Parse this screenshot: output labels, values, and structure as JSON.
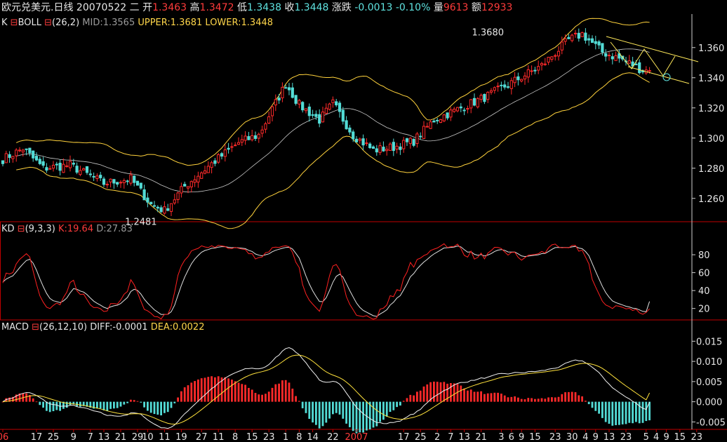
{
  "quote": {
    "name": "欧元兑美元.日线",
    "date": "20070522",
    "weekday": "二",
    "open_label": "开",
    "open": "1.3463",
    "high_label": "高",
    "high": "1.3472",
    "low_label": "低",
    "low": "1.3438",
    "close_label": "收",
    "close": "1.3448",
    "change_label": "涨跌",
    "change": "-0.0013",
    "change_pct": "-0.10%",
    "volume_label": "量",
    "volume": "9613",
    "amount_label": "额",
    "amount": "12933"
  },
  "panels": {
    "boll": {
      "label": "K",
      "name": "BOLL",
      "params": "(26,2)",
      "mid": "MID:1.3565",
      "upper": "UPPER:1.3681",
      "lower": "LOWER:1.3448"
    },
    "kd": {
      "label": "KD",
      "params": "(9,3,3)",
      "k": "K:19.64",
      "d": "D:27.83"
    },
    "macd": {
      "label": "MACD",
      "params": "(26,12,10)",
      "diff": "DIFF:-0.0001",
      "dea": "DEA:0.0022"
    }
  },
  "colors": {
    "up": "#ff2a2a",
    "down": "#53dcd6",
    "band": "#ffd23c",
    "mid": "#c8c8c8",
    "k": "#ff2020",
    "d": "#e0e0e0",
    "frame": "#c00000",
    "axis": "#d0d0d0"
  },
  "chart_data": [
    {
      "type": "candlestick",
      "name": "price",
      "ylim": [
        1.245,
        1.372
      ],
      "yticks": [
        1.26,
        1.28,
        1.3,
        1.32,
        1.34,
        1.36
      ],
      "ytick_labels": [
        "1.260",
        "1.280",
        "1.300",
        "1.320",
        "1.340",
        "1.360"
      ],
      "annotations": [
        {
          "text": "1.3680",
          "value": 1.368,
          "bar": 150
        },
        {
          "text": "1.2481",
          "value": 1.2481,
          "bar": 47
        }
      ],
      "anchors_close": [
        [
          0,
          1.286
        ],
        [
          6,
          1.293
        ],
        [
          12,
          1.28
        ],
        [
          20,
          1.282
        ],
        [
          30,
          1.27
        ],
        [
          38,
          1.273
        ],
        [
          44,
          1.256
        ],
        [
          48,
          1.252
        ],
        [
          54,
          1.268
        ],
        [
          62,
          1.283
        ],
        [
          70,
          1.297
        ],
        [
          76,
          1.302
        ],
        [
          84,
          1.336
        ],
        [
          88,
          1.322
        ],
        [
          94,
          1.312
        ],
        [
          98,
          1.323
        ],
        [
          104,
          1.302
        ],
        [
          110,
          1.292
        ],
        [
          116,
          1.294
        ],
        [
          122,
          1.298
        ],
        [
          128,
          1.312
        ],
        [
          136,
          1.32
        ],
        [
          144,
          1.328
        ],
        [
          152,
          1.338
        ],
        [
          160,
          1.348
        ],
        [
          168,
          1.365
        ],
        [
          172,
          1.369
        ],
        [
          178,
          1.357
        ],
        [
          184,
          1.352
        ],
        [
          190,
          1.345
        ],
        [
          192,
          1.3448
        ]
      ],
      "boll_params": [
        26,
        2
      ],
      "last": {
        "mid": 1.3565,
        "upper": 1.3681,
        "lower": 1.3448
      }
    },
    {
      "type": "line",
      "name": "KD",
      "ylim": [
        8,
        102
      ],
      "yticks": [
        20,
        40,
        60,
        80
      ],
      "ytick_labels": [
        "20",
        "40",
        "60",
        "80"
      ],
      "last": {
        "K": 19.64,
        "D": 27.83
      }
    },
    {
      "type": "bar",
      "name": "MACD",
      "ylim": [
        -0.0065,
        0.0168
      ],
      "yticks": [
        -0.005,
        0.0,
        0.005,
        0.01,
        0.015
      ],
      "ytick_labels": [
        "-0.005",
        "0.000",
        "0.005",
        "0.010",
        "0.015"
      ],
      "last": {
        "DIFF": -0.0001,
        "DEA": 0.0022
      }
    }
  ],
  "xaxis": {
    "labels": [
      [
        "06",
        0
      ],
      [
        "17",
        10
      ],
      [
        "25",
        15
      ],
      [
        "9",
        21
      ],
      [
        "7",
        26
      ],
      [
        "13",
        30
      ],
      [
        "21",
        35
      ],
      [
        "29",
        40
      ],
      [
        "10",
        43
      ],
      [
        "11",
        48
      ],
      [
        "19",
        53
      ],
      [
        "27",
        59
      ],
      [
        "11",
        64
      ],
      [
        "8",
        69
      ],
      [
        "15",
        74
      ],
      [
        "23",
        79
      ],
      [
        "1",
        84
      ],
      [
        "8",
        88
      ],
      [
        "14",
        92
      ],
      [
        "22",
        98
      ],
      [
        "2007",
        105
      ],
      [
        "17",
        119
      ],
      [
        "25",
        124
      ],
      [
        "2",
        129
      ],
      [
        "7",
        133
      ],
      [
        "13",
        137
      ],
      [
        "21",
        142
      ],
      [
        "3",
        148
      ],
      [
        "6",
        151
      ],
      [
        "9",
        154
      ],
      [
        "15",
        158
      ],
      [
        "23",
        164
      ],
      [
        "30",
        169
      ],
      [
        "4",
        173
      ],
      [
        "9",
        176
      ],
      [
        "13",
        180
      ],
      [
        "23",
        185
      ],
      [
        "5",
        191
      ],
      [
        "4",
        194
      ],
      [
        "9",
        197
      ],
      [
        "15",
        201
      ],
      [
        "23",
        206
      ]
    ]
  }
}
